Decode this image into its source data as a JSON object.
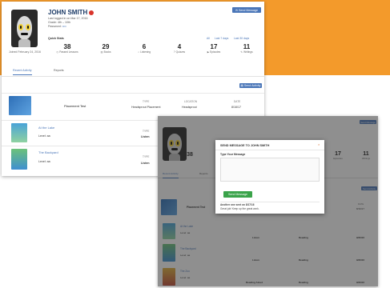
{
  "colors": {
    "accent": "#4a76b8",
    "brand_band": "#f39a2b",
    "alert": "#d9342b",
    "success": "#3aa34a"
  },
  "profile": {
    "name": "JOHN SMITH",
    "last_logged_in": "Last logged in on Mar 17, 2016",
    "grade_label": "Grade:",
    "grade_value": "4th – 10th",
    "password_label": "Password:",
    "password_value": "••••",
    "joined": "Joined February 24, 2016",
    "send_message": "Send Message"
  },
  "quiz": {
    "label": "Quick Stats",
    "links": [
      "All",
      "Last 7 days",
      "Last 30 days"
    ],
    "stats": [
      {
        "value": "38",
        "label": "Passed Lessons",
        "icon": "clock-icon"
      },
      {
        "value": "29",
        "label": "Books",
        "icon": "book-icon"
      },
      {
        "value": "6",
        "label": "Listening",
        "icon": "headphones-icon"
      },
      {
        "value": "4",
        "label": "Quizzes",
        "icon": "question-icon"
      },
      {
        "value": "17",
        "label": "Episodes",
        "icon": "film-icon"
      },
      {
        "value": "11",
        "label": "Writings",
        "icon": "pencil-icon"
      }
    ]
  },
  "tabs": [
    "Recent Activity",
    "Reports"
  ],
  "activity": {
    "send_activity": "Send Activity",
    "headers": {
      "type": "TYPE",
      "location": "LOCATION",
      "date": "DATE"
    },
    "rows": [
      {
        "title": "Placement Test",
        "sub": "",
        "type": "Headsprout Placement",
        "location": "Headsprout",
        "date": "8/16/17"
      },
      {
        "title": "At the Lake",
        "sub": "Level: aa",
        "type": "Listen",
        "location": "Reading",
        "date": "9/30/16"
      },
      {
        "title": "The Backyard",
        "sub": "Level: aa",
        "type": "Listen",
        "location": "Reading",
        "date": "9/30/16"
      },
      {
        "title": "The Zoo",
        "sub": "Level: aa",
        "type": "Reading Aloud",
        "location": "Reading",
        "date": "9/30/16"
      }
    ]
  },
  "modal": {
    "title": "SEND MESSAGE TO JOHN SMITH",
    "close": "×",
    "field_label": "Type Your Message",
    "button": "Send Message",
    "note_title": "Another one sent on 8/17/16",
    "note_body": "Great job! Keep up the great work."
  }
}
